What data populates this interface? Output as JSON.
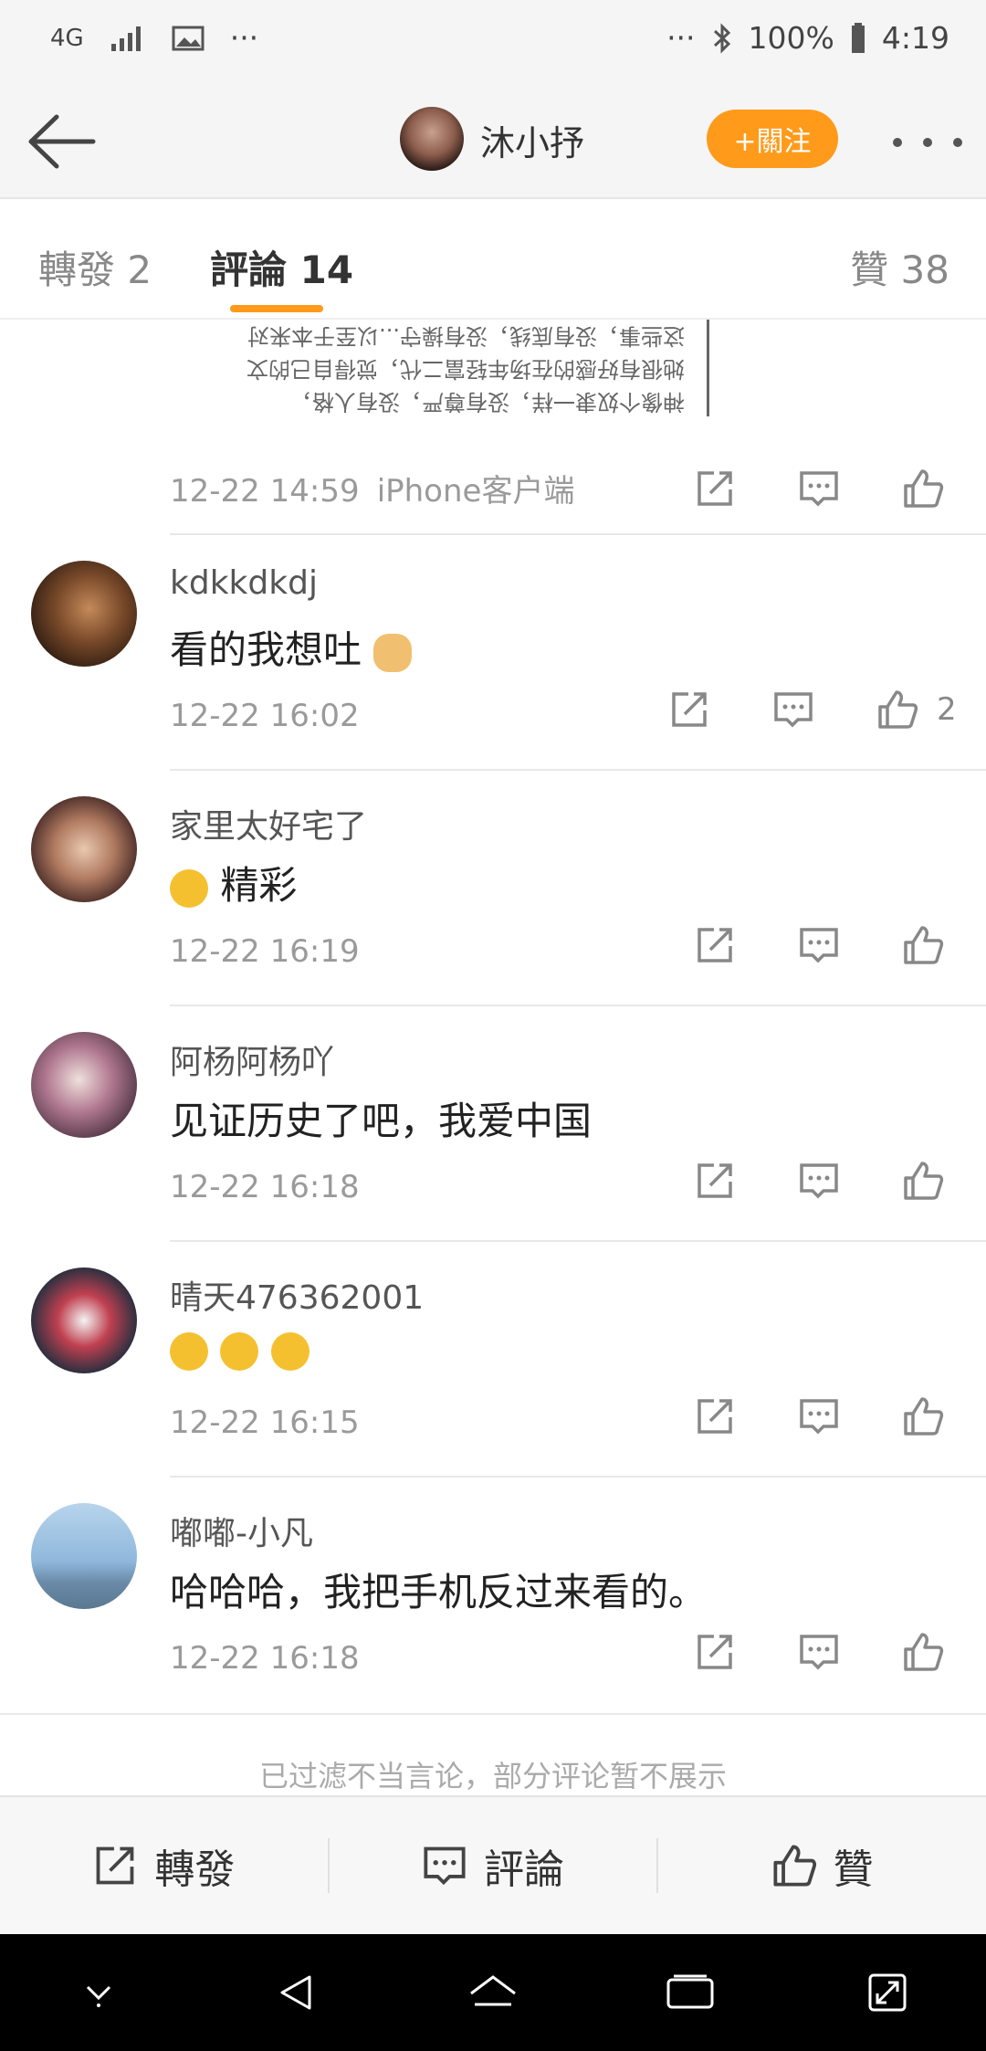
{
  "status_bar": {
    "network": "4G",
    "dots_left": "···",
    "dots_right": "···",
    "battery": "100%",
    "time": "4:19"
  },
  "header": {
    "username": "沐小抒",
    "follow_label": "+關注"
  },
  "tabs": {
    "repost": "轉發 2",
    "comments": "評論 14",
    "likes": "贊 38"
  },
  "post_image": {
    "lines": [
      "这些事，没有底线，没有操守...以至于本来对",
      "她很有好感的在场年轻富二代，觉得自己的文",
      "神像个奴隶一样，没有尊严，没有人格，"
    ]
  },
  "post_meta": {
    "time": "12-22 14:59",
    "source": "iPhone客户端"
  },
  "comments": [
    {
      "name": "kdkkdkdj",
      "text": "看的我想吐",
      "emoji": "cat-emoji",
      "time": "12-22 16:02",
      "likes": "2"
    },
    {
      "name": "家里太好宅了",
      "text": "精彩",
      "emoji": "laugh-cry-emoji",
      "time": "12-22 16:19",
      "likes": ""
    },
    {
      "name": "阿杨阿杨吖",
      "text": "见证历史了吧，我爱中国",
      "emoji": "",
      "time": "12-22 16:18",
      "likes": ""
    },
    {
      "name": "晴天476362001",
      "text": "",
      "emoji": "cover-eyes-emoji x3",
      "time": "12-22 16:15",
      "likes": ""
    },
    {
      "name": "嘟嘟-小凡",
      "text": "哈哈哈，我把手机反过来看的。",
      "emoji": "",
      "time": "12-22 16:18",
      "likes": ""
    }
  ],
  "filtered_notice": "已过滤不当言论，部分评论暂不展示",
  "bottom_bar": {
    "repost": "轉發",
    "comment": "評論",
    "like": "贊"
  },
  "colors": {
    "accent": "#ff9a1a",
    "header_bg": "#f5f5f5",
    "nav_bg": "#000000"
  }
}
